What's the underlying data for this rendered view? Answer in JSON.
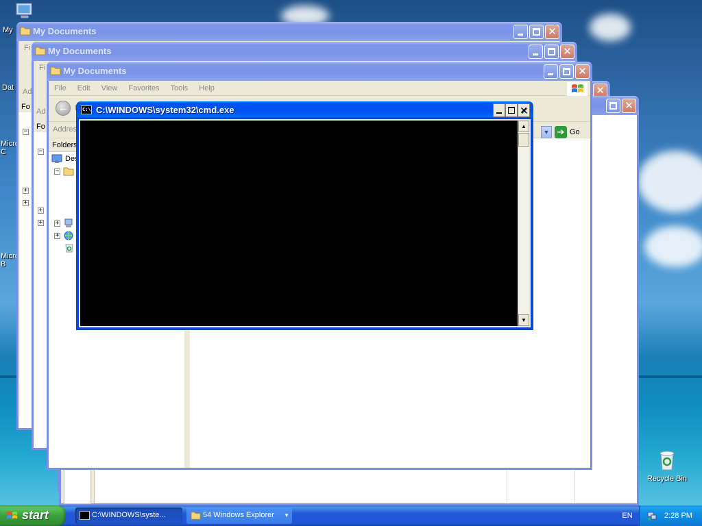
{
  "desktop": {
    "icons": [
      {
        "label": "My",
        "name": "my-computer"
      },
      {
        "label": "Dat",
        "name": "data"
      },
      {
        "label": "Micro C",
        "name": "microsoft-c"
      },
      {
        "label": "Micro B",
        "name": "microsoft-b"
      },
      {
        "label": "Recycle Bin",
        "name": "recycle-bin"
      }
    ]
  },
  "explorer": {
    "title": "My Documents",
    "menu": [
      "File",
      "Edit",
      "View",
      "Favorites",
      "Tools",
      "Help"
    ],
    "back_label": "B",
    "address_label": "Addres",
    "folders_label": "Folders",
    "tree_desktop": "Des",
    "go_label": "Go",
    "peek_fi": "Fi",
    "peek_ad": "Ad",
    "peek_fo": "Fo"
  },
  "cmd": {
    "title": "C:\\WINDOWS\\system32\\cmd.exe",
    "icon_text": "C:\\"
  },
  "taskbar": {
    "start_label": "start",
    "buttons": [
      {
        "label": "C:\\WINDOWS\\syste...",
        "icon": "cmd-icon",
        "active": true
      },
      {
        "label": "54 Windows Explorer",
        "icon": "folder-icon",
        "active": false
      }
    ],
    "language": "EN",
    "clock": "2:28 PM"
  },
  "colors": {
    "title_active": "#0053ee",
    "title_inactive": "#7a93e6",
    "taskbar": "#2157d7",
    "start_green": "#3c9e3c",
    "console_bg": "#000000"
  }
}
